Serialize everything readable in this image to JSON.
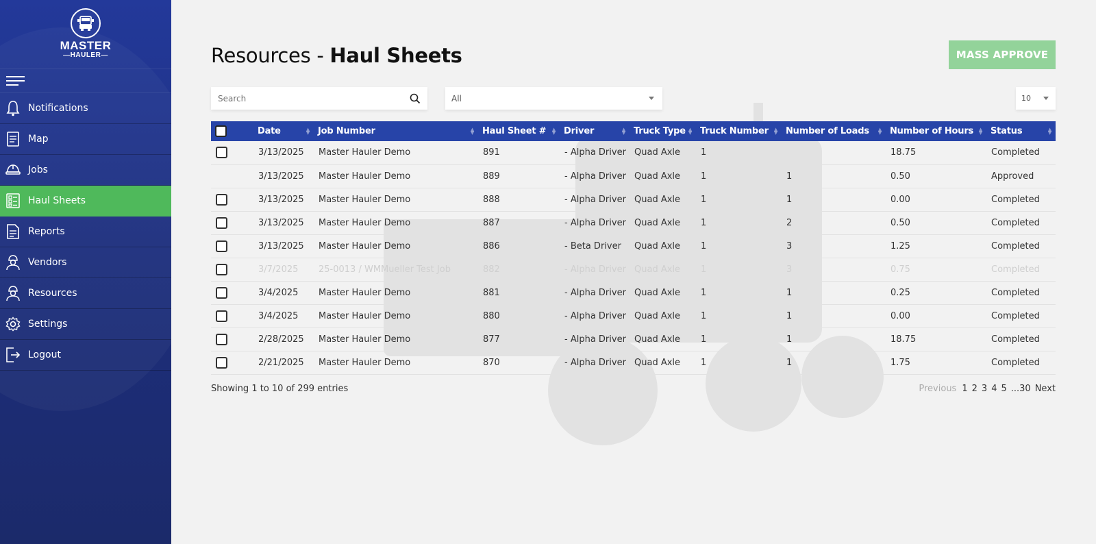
{
  "brand": {
    "title": "MASTER",
    "subtitle": "HAULER"
  },
  "sidebar": {
    "items": [
      {
        "label": "Notifications",
        "icon": "bell-icon"
      },
      {
        "label": "Map",
        "icon": "document-icon"
      },
      {
        "label": "Jobs",
        "icon": "hard-hat-icon"
      },
      {
        "label": "Haul Sheets",
        "icon": "checklist-icon",
        "active": true
      },
      {
        "label": "Reports",
        "icon": "report-icon"
      },
      {
        "label": "Vendors",
        "icon": "worker-icon"
      },
      {
        "label": "Resources",
        "icon": "worker-icon"
      },
      {
        "label": "Settings",
        "icon": "gear-icon"
      },
      {
        "label": "Logout",
        "icon": "logout-icon"
      }
    ]
  },
  "page": {
    "title_prefix": "Resources - ",
    "title_bold": "Haul Sheets"
  },
  "toolbar": {
    "mass_approve_label": "MASS APPROVE",
    "search_placeholder": "Search",
    "filter_value": "All",
    "page_size_value": "10"
  },
  "table": {
    "columns": [
      "Date",
      "Job Number",
      "Haul Sheet #",
      "Driver",
      "Truck Type",
      "Truck Number",
      "Number of Loads",
      "Number of Hours",
      "Status"
    ],
    "rows": [
      {
        "checkbox": true,
        "faded": false,
        "cells": [
          "3/13/2025",
          "Master Hauler Demo",
          "891",
          "- Alpha Driver",
          "Quad Axle",
          "1",
          "",
          "18.75",
          "Completed"
        ]
      },
      {
        "checkbox": false,
        "faded": false,
        "cells": [
          "3/13/2025",
          "Master Hauler Demo",
          "889",
          "- Alpha Driver",
          "Quad Axle",
          "1",
          "1",
          "0.50",
          "Approved"
        ]
      },
      {
        "checkbox": true,
        "faded": false,
        "cells": [
          "3/13/2025",
          "Master Hauler Demo",
          "888",
          "- Alpha Driver",
          "Quad Axle",
          "1",
          "1",
          "0.00",
          "Completed"
        ]
      },
      {
        "checkbox": true,
        "faded": false,
        "cells": [
          "3/13/2025",
          "Master Hauler Demo",
          "887",
          "- Alpha Driver",
          "Quad Axle",
          "1",
          "2",
          "0.50",
          "Completed"
        ]
      },
      {
        "checkbox": true,
        "faded": false,
        "cells": [
          "3/13/2025",
          "Master Hauler Demo",
          "886",
          "- Beta Driver",
          "Quad Axle",
          "1",
          "3",
          "1.25",
          "Completed"
        ]
      },
      {
        "checkbox": true,
        "faded": true,
        "cells": [
          "3/7/2025",
          "25-0013 / WMMueller Test Job",
          "882",
          "- Alpha Driver",
          "Quad Axle",
          "1",
          "3",
          "0.75",
          "Completed"
        ]
      },
      {
        "checkbox": true,
        "faded": false,
        "cells": [
          "3/4/2025",
          "Master Hauler Demo",
          "881",
          "- Alpha Driver",
          "Quad Axle",
          "1",
          "1",
          "0.25",
          "Completed"
        ]
      },
      {
        "checkbox": true,
        "faded": false,
        "cells": [
          "3/4/2025",
          "Master Hauler Demo",
          "880",
          "- Alpha Driver",
          "Quad Axle",
          "1",
          "1",
          "0.00",
          "Completed"
        ]
      },
      {
        "checkbox": true,
        "faded": false,
        "cells": [
          "2/28/2025",
          "Master Hauler Demo",
          "877",
          "- Alpha Driver",
          "Quad Axle",
          "1",
          "1",
          "18.75",
          "Completed"
        ]
      },
      {
        "checkbox": true,
        "faded": false,
        "cells": [
          "2/21/2025",
          "Master Hauler Demo",
          "870",
          "- Alpha Driver",
          "Quad Axle",
          "1",
          "1",
          "1.75",
          "Completed"
        ]
      }
    ]
  },
  "footer": {
    "info": "Showing 1 to 10 of 299 entries",
    "pagination": [
      "Previous",
      "1",
      "2",
      "3",
      "4",
      "5",
      "...30",
      "Next"
    ]
  },
  "colors": {
    "sidebar": "#23399a",
    "active": "#4fb95b",
    "header": "#2744a8",
    "mass_approve": "#93d39a"
  }
}
